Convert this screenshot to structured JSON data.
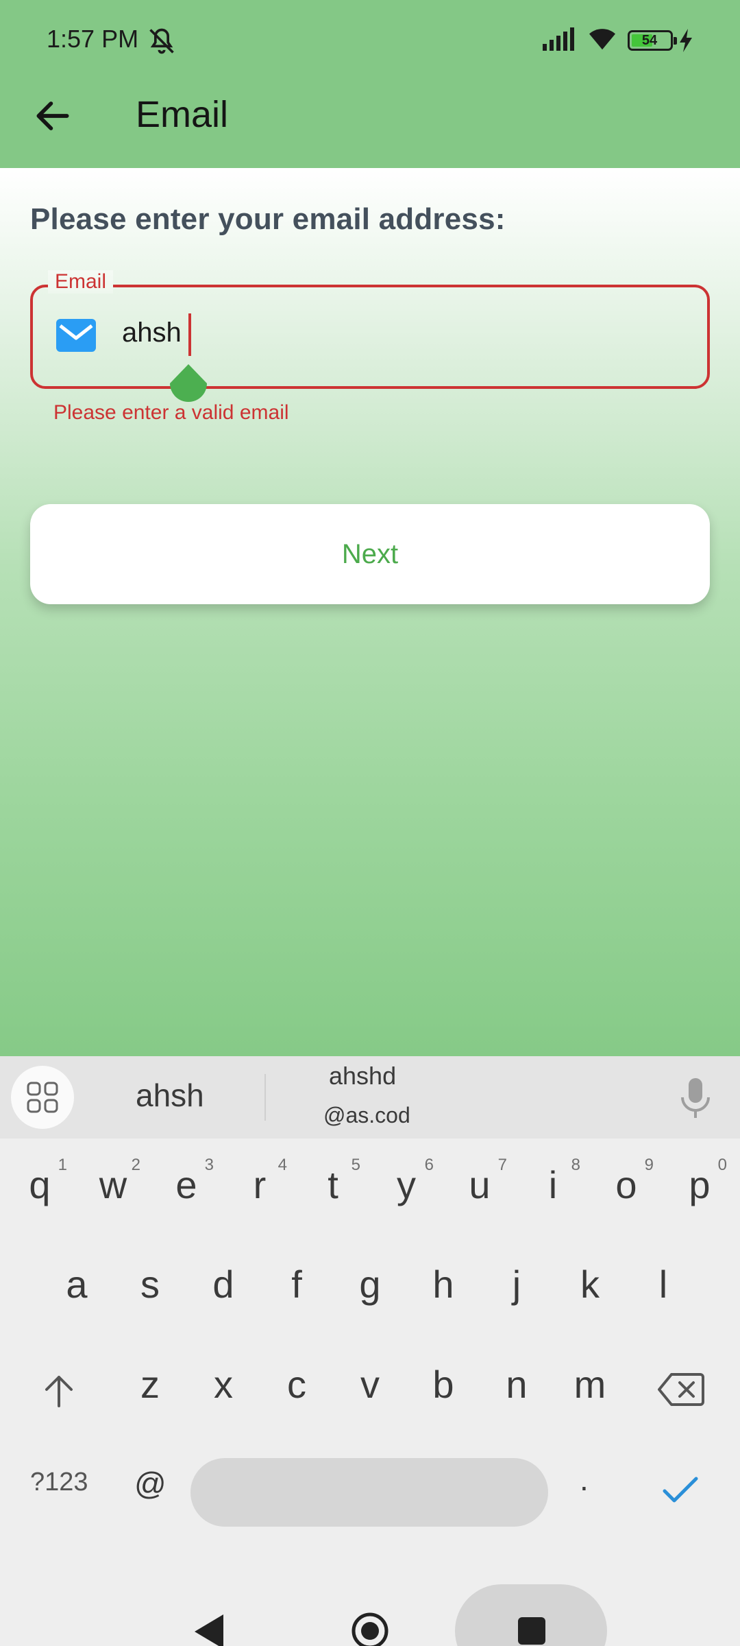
{
  "status_bar": {
    "time": "1:57 PM",
    "battery_level": "54",
    "icons": [
      "bell-off-icon",
      "signal-icon",
      "wifi-icon",
      "battery-icon",
      "charging-bolt-icon"
    ]
  },
  "app_bar": {
    "back_icon": "arrow-left-icon",
    "title": "Email"
  },
  "form": {
    "prompt": "Please enter your email address:",
    "email_field": {
      "label": "Email",
      "icon": "mail-icon",
      "value": "ahsh",
      "error": "Please enter a valid email"
    },
    "next_button": "Next"
  },
  "keyboard": {
    "suggestions": {
      "primary": "ahsh",
      "secondary_top": "ahshd",
      "secondary_bottom": "@as.cod"
    },
    "row1": [
      {
        "k": "q",
        "h": "1"
      },
      {
        "k": "w",
        "h": "2"
      },
      {
        "k": "e",
        "h": "3"
      },
      {
        "k": "r",
        "h": "4"
      },
      {
        "k": "t",
        "h": "5"
      },
      {
        "k": "y",
        "h": "6"
      },
      {
        "k": "u",
        "h": "7"
      },
      {
        "k": "i",
        "h": "8"
      },
      {
        "k": "o",
        "h": "9"
      },
      {
        "k": "p",
        "h": "0"
      }
    ],
    "row2": [
      "a",
      "s",
      "d",
      "f",
      "g",
      "h",
      "j",
      "k",
      "l"
    ],
    "row3": [
      "z",
      "x",
      "c",
      "v",
      "b",
      "n",
      "m"
    ],
    "symbols_key": "?123",
    "at_key": "@",
    "dot_key": "."
  },
  "colors": {
    "primary_green": "#84c886",
    "error_red": "#cc3333",
    "button_text": "#4caa4c"
  }
}
